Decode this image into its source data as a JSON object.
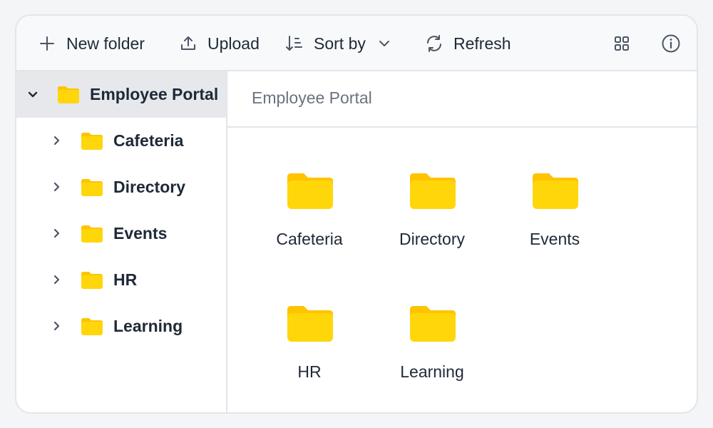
{
  "toolbar": {
    "new_folder": "New folder",
    "upload": "Upload",
    "sort_by": "Sort by",
    "refresh": "Refresh"
  },
  "sidebar": {
    "root": {
      "label": "Employee Portal",
      "expanded": true,
      "selected": true
    },
    "items": [
      {
        "label": "Cafeteria"
      },
      {
        "label": "Directory"
      },
      {
        "label": "Events"
      },
      {
        "label": "HR"
      },
      {
        "label": "Learning"
      }
    ]
  },
  "main": {
    "breadcrumb": "Employee Portal",
    "folders": [
      {
        "label": "Cafeteria"
      },
      {
        "label": "Directory"
      },
      {
        "label": "Events"
      },
      {
        "label": "HR"
      },
      {
        "label": "Learning"
      }
    ]
  },
  "colors": {
    "folder": "#ffd60a",
    "folder_tab": "#ffc300",
    "selected_bg": "#e6e8ec"
  }
}
